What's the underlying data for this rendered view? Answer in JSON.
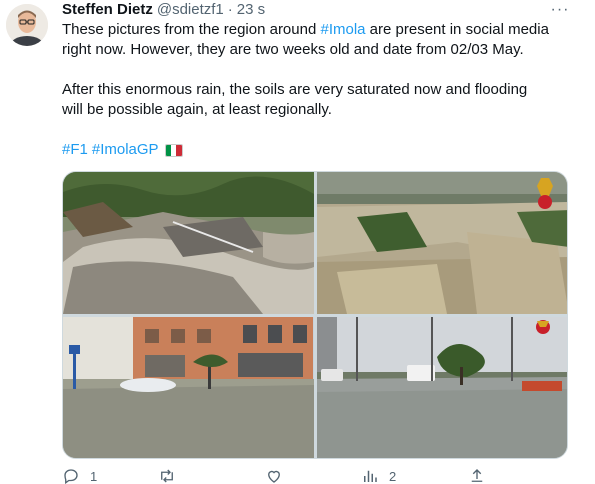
{
  "tweet": {
    "author": {
      "name": "Steffen Dietz",
      "handle": "@sdietzf1",
      "separator": "·",
      "time": "23 s"
    },
    "text": {
      "line1_pre": "These pictures from the region around ",
      "line1_tag": "#Imola",
      "line1_post": " are present in social media",
      "line2": "right now. However, they are two weeks old and date from 02/03 May.",
      "line3": "After this enormous rain, the soils are very saturated now and flooding",
      "line4": "will be possible again, at least regionally.",
      "hashtags": [
        "#F1",
        "#ImolaGP"
      ]
    },
    "flag_colors": [
      "#009246",
      "#ffffff",
      "#ce2b37"
    ],
    "accent_color": "#1d9bf0",
    "media": [
      {
        "icon": "photo-collapsed-road-bridge"
      },
      {
        "icon": "photo-aerial-flooded-fields"
      },
      {
        "icon": "photo-flooded-street-buildings"
      },
      {
        "icon": "photo-flooded-road-vans"
      }
    ],
    "actions": {
      "reply_count": "1",
      "retweet_count": "",
      "like_count": "",
      "views_count": "2"
    }
  }
}
